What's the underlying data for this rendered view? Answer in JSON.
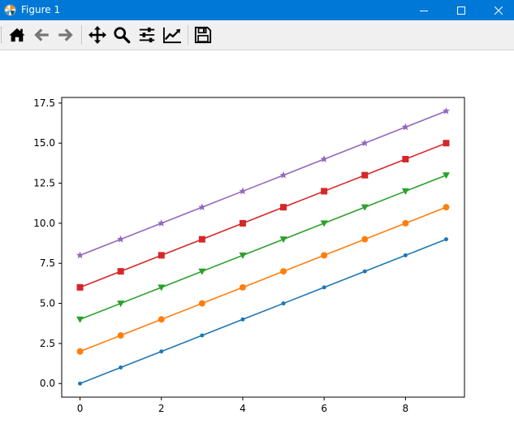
{
  "window": {
    "title": "Figure 1",
    "titlebar_color": "#0078d7"
  },
  "window_controls": [
    {
      "name": "minimize-button",
      "icon": "minimize-icon"
    },
    {
      "name": "maximize-button",
      "icon": "maximize-icon"
    },
    {
      "name": "close-button",
      "icon": "close-icon"
    }
  ],
  "toolbar": {
    "buttons": [
      {
        "name": "home-button",
        "icon": "home-icon"
      },
      {
        "name": "back-button",
        "icon": "back-arrow-icon"
      },
      {
        "name": "forward-button",
        "icon": "forward-arrow-icon"
      },
      {
        "name": "pan-button",
        "icon": "move-icon"
      },
      {
        "name": "zoom-button",
        "icon": "magnifier-icon"
      },
      {
        "name": "subplots-button",
        "icon": "sliders-icon"
      },
      {
        "name": "edit-axis-button",
        "icon": "line-chart-icon"
      },
      {
        "name": "save-button",
        "icon": "floppy-disk-icon"
      }
    ]
  },
  "chart_data": {
    "type": "line",
    "title": "",
    "xlabel": "",
    "ylabel": "",
    "xlim": [
      -0.45,
      9.45
    ],
    "ylim": [
      -0.85,
      17.85
    ],
    "x": [
      0,
      1,
      2,
      3,
      4,
      5,
      6,
      7,
      8,
      9
    ],
    "x_ticks": [
      "0",
      "2",
      "4",
      "6",
      "8"
    ],
    "y_ticks": [
      "0.0",
      "2.5",
      "5.0",
      "7.5",
      "10.0",
      "12.5",
      "15.0",
      "17.5"
    ],
    "grid": false,
    "series": [
      {
        "marker": "point",
        "color": "#1f77b4",
        "values": [
          0,
          1,
          2,
          3,
          4,
          5,
          6,
          7,
          8,
          9
        ]
      },
      {
        "marker": "circle",
        "color": "#ff7f0e",
        "values": [
          2,
          3,
          4,
          5,
          6,
          7,
          8,
          9,
          10,
          11
        ]
      },
      {
        "marker": "triangle-down",
        "color": "#2ca02c",
        "values": [
          4,
          5,
          6,
          7,
          8,
          9,
          10,
          11,
          12,
          13
        ]
      },
      {
        "marker": "square",
        "color": "#d62728",
        "values": [
          6,
          7,
          8,
          9,
          10,
          11,
          12,
          13,
          14,
          15
        ]
      },
      {
        "marker": "star",
        "color": "#9467bd",
        "values": [
          8,
          9,
          10,
          11,
          12,
          13,
          14,
          15,
          16,
          17
        ]
      }
    ]
  }
}
